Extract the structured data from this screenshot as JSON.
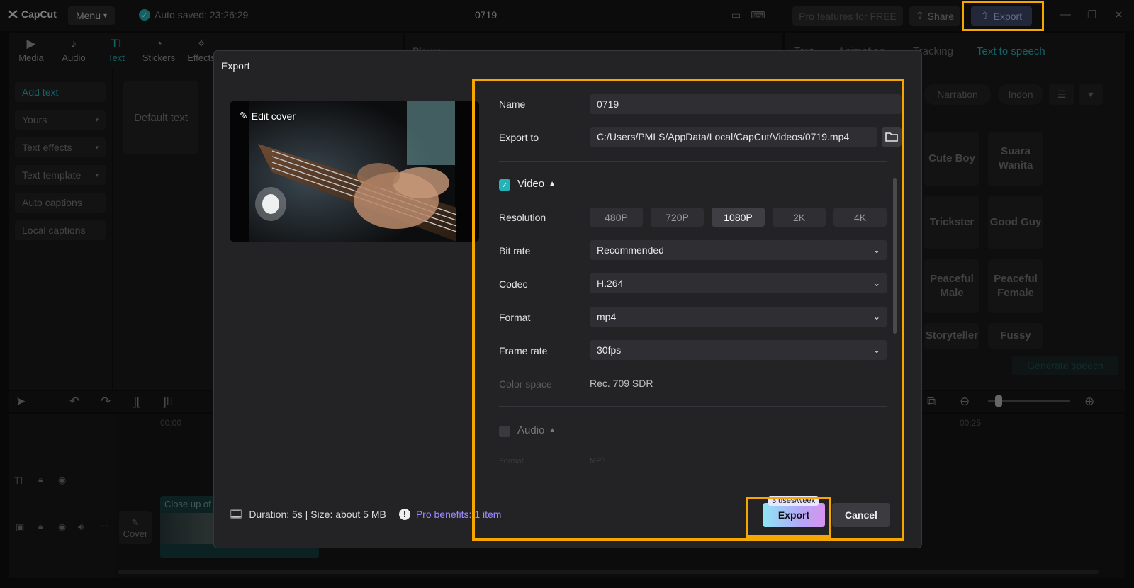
{
  "app": {
    "logo": "CapCut",
    "menu_label": "Menu",
    "autosave": "Auto saved: 23:26:29",
    "project_title": "0719",
    "pro_features": "Pro features for FREE",
    "share_label": "Share",
    "export_label": "Export"
  },
  "toolbar": {
    "items": [
      {
        "label": "Media",
        "icon": "media-icon"
      },
      {
        "label": "Audio",
        "icon": "audio-icon"
      },
      {
        "label": "Text",
        "icon": "text-icon"
      },
      {
        "label": "Stickers",
        "icon": "stickers-icon"
      },
      {
        "label": "Effects",
        "icon": "effects-icon"
      }
    ]
  },
  "leftnav": {
    "items": [
      "Add text",
      "Yours",
      "Text effects",
      "Text template",
      "Auto captions",
      "Local captions"
    ]
  },
  "text_panel": {
    "default_text": "Default text"
  },
  "player": {
    "title": "Player"
  },
  "rightpanel": {
    "tabs": [
      "Text",
      "Animation",
      "Tracking",
      "Text to speech"
    ],
    "pills": [
      "Narration",
      "Indon"
    ],
    "voices": [
      "Cute Boy",
      "Suara Wanita",
      "Trickster",
      "Good Guy",
      "Peaceful Male",
      "Peaceful Female",
      "Storyteller",
      "Fussy"
    ],
    "generate": "Generate speech"
  },
  "timeline": {
    "time_start": "00:00",
    "time_end": "00:25",
    "clip_label": "Close up of",
    "cover_label": "Cover"
  },
  "modal": {
    "title": "Export",
    "edit_cover": "Edit cover",
    "name_label": "Name",
    "name_value": "0719",
    "export_to_label": "Export to",
    "export_to_value": "C:/Users/PMLS/AppData/Local/CapCut/Videos/0719.mp4",
    "video_label": "Video",
    "resolution_label": "Resolution",
    "resolutions": [
      "480P",
      "720P",
      "1080P",
      "2K",
      "4K"
    ],
    "resolution_selected": "1080P",
    "bitrate_label": "Bit rate",
    "bitrate_value": "Recommended",
    "codec_label": "Codec",
    "codec_value": "H.264",
    "format_label": "Format",
    "format_value": "mp4",
    "framerate_label": "Frame rate",
    "framerate_value": "30fps",
    "colorspace_label": "Color space",
    "colorspace_value": "Rec. 709 SDR",
    "audio_label": "Audio",
    "audio_format_label": "Format",
    "audio_format_value": "MP3",
    "duration_info": "Duration: 5s | Size: about 5 MB",
    "pro_benefits": "Pro benefits: 1 item",
    "uses_badge": "3 uses/week",
    "export_button": "Export",
    "cancel_button": "Cancel"
  },
  "colors": {
    "accent": "#26b3b8",
    "highlight": "#f5a700",
    "pro": "#9b8cff"
  }
}
